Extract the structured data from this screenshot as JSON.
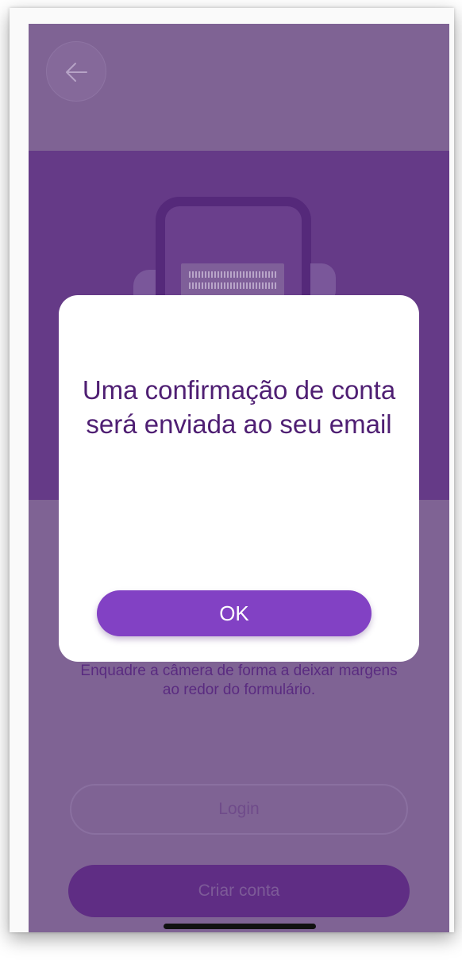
{
  "header": {
    "back_icon": "arrow-left-icon"
  },
  "instructions": {
    "line1": "Enquadre a câmera de forma a deixar margens",
    "line2": "ao redor do formulário."
  },
  "buttons": {
    "login_label": "Login",
    "create_account_label": "Criar conta"
  },
  "dialog": {
    "message": "Uma confirmação de conta será enviada ao seu email",
    "ok_label": "OK"
  },
  "colors": {
    "overlay_bg": "#7f6394",
    "illustration_band": "#653a87",
    "primary_button": "#8241c4",
    "dialog_text": "#4f1f73"
  }
}
